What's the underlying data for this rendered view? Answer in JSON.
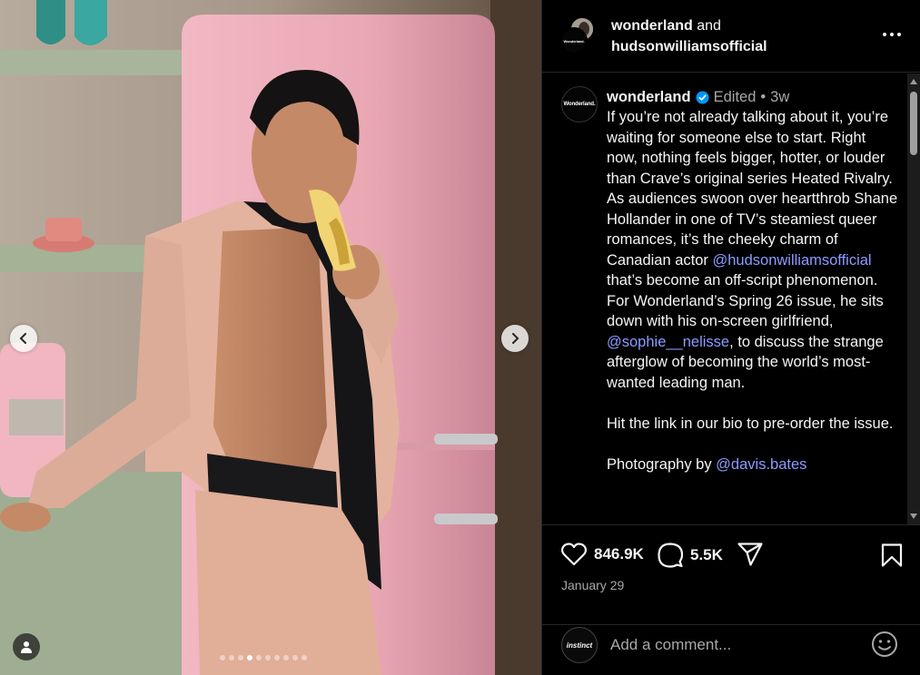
{
  "header": {
    "account_primary": "wonderland",
    "joiner": "and",
    "account_secondary": "hudsonwilliamsofficial"
  },
  "post": {
    "username": "wonderland",
    "edited_label": "Edited",
    "separator": "•",
    "age": "3w",
    "caption": {
      "p1_a": "If you’re not already talking about it, you’re waiting for someone else to start. Right now, nothing feels bigger, hotter, or louder than Crave’s original series Heated Rivalry. As audiences swoon over heartthrob Shane Hollander in one of TV’s steamiest queer romances, it’s the cheeky charm of Canadian actor ",
      "mention_1": "@hudsonwilliamsofficial",
      "p1_b": " that’s become an off-script phenomenon. For Wonderland’s Spring 26 issue, he sits down with his on-screen girlfriend, ",
      "mention_2": "@sophie__nelisse",
      "p1_c": ", to discuss the strange afterglow of becoming the world’s most-wanted leading man.",
      "p2": "Hit the link in our bio to pre-order the issue.",
      "p3_a": "Photography by ",
      "mention_3": "@davis.bates"
    },
    "avatar_logo_text": "Wonderland."
  },
  "actions": {
    "likes": "846.9K",
    "comments": "5.5K",
    "date": "January 29"
  },
  "comment_box": {
    "placeholder": "Add a comment...",
    "user_avatar_text": "instinct"
  },
  "carousel": {
    "total": 10,
    "active_index": 4
  },
  "colors": {
    "background": "#000000",
    "text": "#f5f5f5",
    "secondary_text": "#a8a8a8",
    "mention": "#8c9bff",
    "verified": "#0095f6",
    "fridge_pink": "#e9a9b5"
  }
}
